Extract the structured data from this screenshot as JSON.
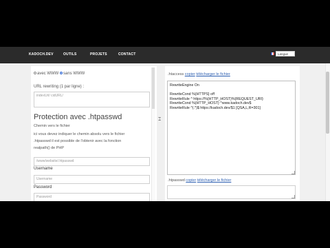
{
  "nav": {
    "items": [
      "KADOCH.DEV",
      "OUTILS",
      "PROJETS",
      "CONTACT"
    ],
    "language_label": "Langue"
  },
  "left": {
    "radio_with": "avec WWW",
    "radio_without": "sans WWW",
    "rewrite_label": "URL rewriting (1 par ligne) :",
    "rewrite_placeholder": "indexUrl/ cidURL/",
    "section_title": "Protection avec .htpasswd",
    "path_label": "Chemin vers le fichier",
    "help_line1": "ici vous devez indiquer le chemin absolu vers le fichier",
    "help_line2": ".htpasswd il est possible de l'obtenir avec la fonction",
    "help_line3": "realpath() de PHP",
    "path_placeholder": "/www/website/.htpasswd",
    "username_label": "Username",
    "username_placeholder": "Username",
    "password_label": "Password",
    "password_placeholder": "Password"
  },
  "right": {
    "htaccess_label": ".htaccess",
    "copy": "copier",
    "download": "télécharger le fichier",
    "code": "RewriteEngine On\n\nRewriteCond %{HTTPS} off\nRewriteRule ^ https://%{HTTP_HOST}%{REQUEST_URI}\nRewriteCond %{HTTP_HOST} ^www.kadoch.dev$\nRewriteRule ^(.*)$ https://kadoch.dev/$1 [QSA,L,R=301]",
    "htpasswd_label": ".htpasswd",
    "copy2": "copier",
    "download2": "télécharger le fichier"
  }
}
